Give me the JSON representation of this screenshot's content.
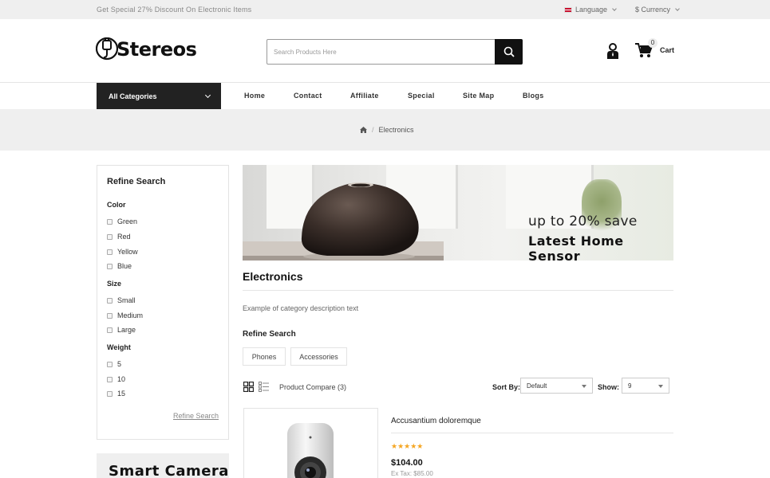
{
  "topbar": {
    "promo": "Get Special 27% Discount On Electronic Items",
    "language": "Language",
    "currency": "$ Currency"
  },
  "header": {
    "logo_text": "Stereos",
    "search_placeholder": "Search Products Here",
    "cart_count": "0",
    "cart_label": "Cart"
  },
  "nav": {
    "all_categories": "All Categories",
    "items": [
      "Home",
      "Contact",
      "Affiliate",
      "Special",
      "Site Map",
      "Blogs"
    ]
  },
  "breadcrumb": {
    "current": "Electronics"
  },
  "sidebar": {
    "title": "Refine Search",
    "groups": {
      "color": {
        "label": "Color",
        "options": [
          "Green",
          "Red",
          "Yellow",
          "Blue"
        ]
      },
      "size": {
        "label": "Size",
        "options": [
          "Small",
          "Medium",
          "Large"
        ]
      },
      "weight": {
        "label": "Weight",
        "options": [
          "5",
          "10",
          "15"
        ]
      }
    },
    "refine_link": "Refine Search",
    "promo_text": "Smart Camera"
  },
  "banner": {
    "line1": "up to 20% save",
    "line2": "Latest Home Sensor"
  },
  "category": {
    "title": "Electronics",
    "description": "Example of category description text",
    "refine_title": "Refine Search",
    "subcategories": [
      "Phones",
      "Accessories"
    ]
  },
  "toolbar": {
    "compare": "Product Compare (3)",
    "sort_label": "Sort By:",
    "sort_value": "Default",
    "show_label": "Show:",
    "show_value": "9"
  },
  "product": {
    "name": "Accusantium doloremque",
    "rating": 5,
    "stars": "★★★★★",
    "price": "$104.00",
    "ex_tax": "Ex Tax: $85.00"
  },
  "colors": {
    "accent_dark": "#222222",
    "star": "#f5a623",
    "band": "#efefef"
  }
}
